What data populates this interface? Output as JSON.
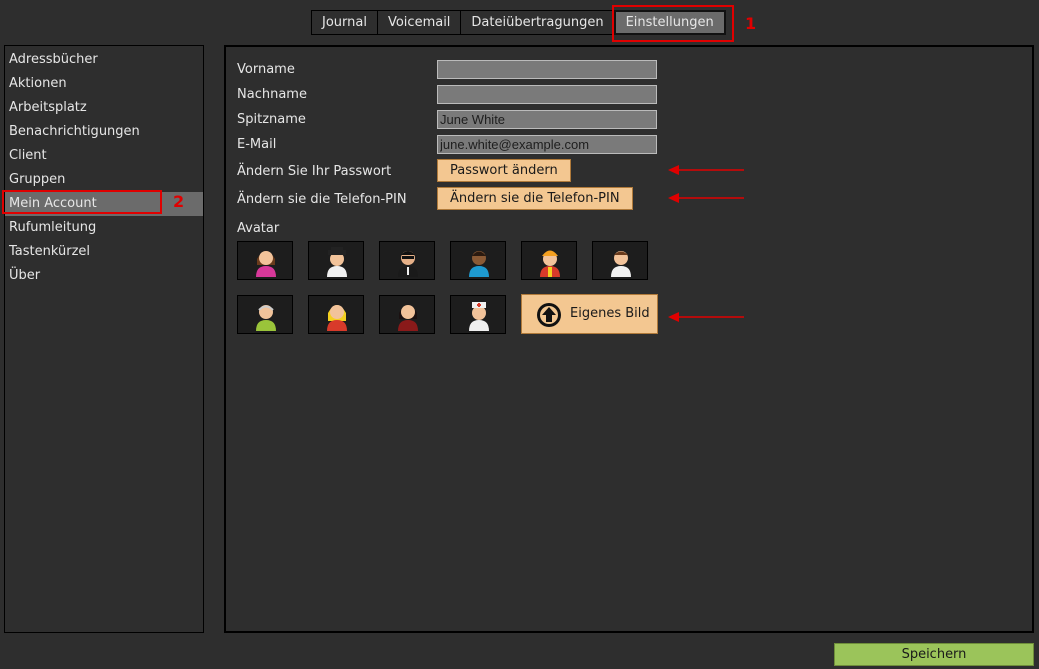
{
  "tabs": [
    {
      "label": "Journal"
    },
    {
      "label": "Voicemail"
    },
    {
      "label": "Dateiübertragungen"
    },
    {
      "label": "Einstellungen"
    }
  ],
  "annotations": {
    "marker1": "1",
    "marker2": "2",
    "color": "#e00000"
  },
  "sidebar": {
    "items": [
      {
        "label": "Adressbücher"
      },
      {
        "label": "Aktionen"
      },
      {
        "label": "Arbeitsplatz"
      },
      {
        "label": "Benachrichtigungen"
      },
      {
        "label": "Client"
      },
      {
        "label": "Gruppen"
      },
      {
        "label": "Mein Account"
      },
      {
        "label": "Rufumleitung"
      },
      {
        "label": "Tastenkürzel"
      },
      {
        "label": "Über"
      }
    ],
    "selected": "Mein Account"
  },
  "account": {
    "first_name_label": "Vorname",
    "first_name_value": "",
    "last_name_label": "Nachname",
    "last_name_value": "",
    "nickname_label": "Spitzname",
    "nickname_value": "June White",
    "email_label": "E-Mail",
    "email_value": "june.white@example.com",
    "password_label": "Ändern Sie Ihr Passwort",
    "password_button": "Passwort ändern",
    "pin_label": "Ändern sie die Telefon-PIN",
    "pin_button": "Ändern sie die Telefon-PIN",
    "avatar_label": "Avatar",
    "own_image_button": "Eigenes Bild"
  },
  "avatars": [
    {
      "icon": "woman-pink-avatar-icon"
    },
    {
      "icon": "man-white-hat-avatar-icon"
    },
    {
      "icon": "man-sunglasses-avatar-icon"
    },
    {
      "icon": "man-blue-shirt-avatar-icon"
    },
    {
      "icon": "worker-helmet-avatar-icon"
    },
    {
      "icon": "man-white-avatar-icon"
    },
    {
      "icon": "old-man-green-avatar-icon"
    },
    {
      "icon": "blonde-red-dress-avatar-icon"
    },
    {
      "icon": "woman-dark-red-avatar-icon"
    },
    {
      "icon": "doctor-avatar-icon"
    }
  ],
  "footer": {
    "save_button": "Speichern"
  },
  "colors": {
    "background": "#2e2e2e",
    "selected": "#6b6b6b",
    "orange_button": "#f3c791",
    "save_button": "#9bc45a",
    "highlight": "#e00000"
  }
}
